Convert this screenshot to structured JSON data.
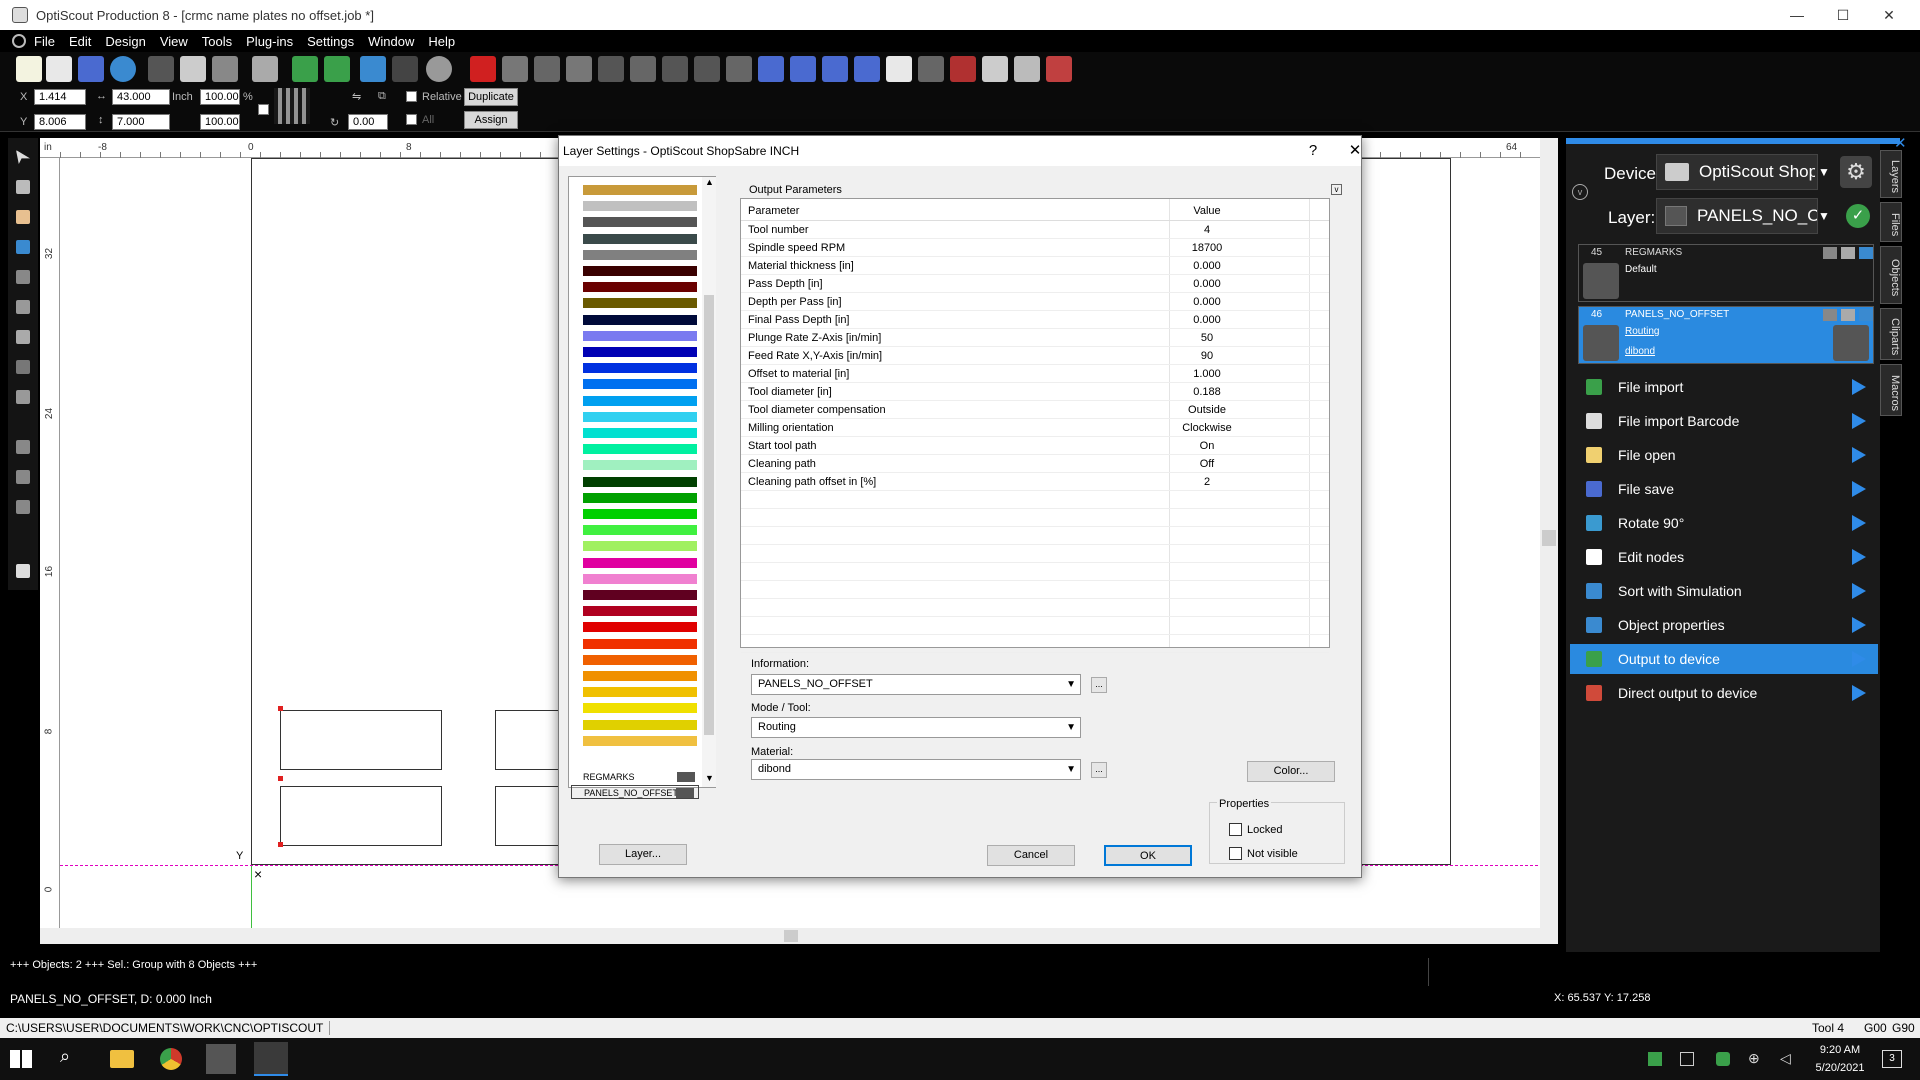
{
  "window": {
    "title": "OptiScout Production 8 - [crmc name plates no offset.job *]",
    "controls": [
      "—",
      "☐",
      "✕"
    ]
  },
  "menu": [
    "File",
    "Edit",
    "Design",
    "View",
    "Tools",
    "Plug-ins",
    "Settings",
    "Window",
    "Help"
  ],
  "propbar": {
    "x_label": "X",
    "x_value": "1.414",
    "y_label": "Y",
    "y_value": "8.006",
    "width_value": "43.000",
    "height_value": "7.000",
    "unit": "Inch",
    "scale_w": "100.00",
    "scale_h": "100.00",
    "percent": "%",
    "rotation": "0.00",
    "relative_label": "Relative",
    "all_label": "All",
    "duplicate_label": "Duplicate",
    "assign_label": "Assign"
  },
  "ruler": {
    "unit_label": "in",
    "x_ticks": [
      "-8",
      "0",
      "8",
      "64"
    ],
    "y_ticks": [
      "32",
      "24",
      "16",
      "8",
      "0"
    ]
  },
  "dialog": {
    "title": "Layer Settings - OptiScout ShopSabre INCH",
    "help": "?",
    "close": "✕",
    "group_label": "Output Parameters",
    "col_param": "Parameter",
    "col_value": "Value",
    "params": [
      {
        "name": "Tool number",
        "value": "4"
      },
      {
        "name": "Spindle speed RPM",
        "value": "18700"
      },
      {
        "name": "Material thickness [in]",
        "value": "0.000"
      },
      {
        "name": "Pass Depth [in]",
        "value": "0.000"
      },
      {
        "name": "Depth per Pass [in]",
        "value": "0.000"
      },
      {
        "name": "Final Pass Depth [in]",
        "value": "0.000"
      },
      {
        "name": "Plunge Rate Z-Axis [in/min]",
        "value": "50"
      },
      {
        "name": "Feed Rate X,Y-Axis [in/min]",
        "value": "90"
      },
      {
        "name": "Offset to material [in]",
        "value": "1.000"
      },
      {
        "name": "Tool diameter [in]",
        "value": "0.188"
      },
      {
        "name": "Tool diameter compensation",
        "value": "Outside"
      },
      {
        "name": "Milling orientation",
        "value": "Clockwise"
      },
      {
        "name": "Start tool path",
        "value": "On"
      },
      {
        "name": "Cleaning path",
        "value": "Off"
      },
      {
        "name": "Cleaning path offset in [%]",
        "value": "2"
      }
    ],
    "information_label": "Information:",
    "information_value": "PANELS_NO_OFFSET",
    "mode_label": "Mode / Tool:",
    "mode_value": "Routing",
    "material_label": "Material:",
    "material_value": "dibond",
    "color_button": "Color...",
    "properties_label": "Properties",
    "locked_label": "Locked",
    "not_visible_label": "Not visible",
    "layer_button": "Layer...",
    "cancel_button": "Cancel",
    "ok_button": "OK",
    "ellipsis": "...",
    "swatch_layers": [
      "REGMARKS",
      "PANELS_NO_OFFSET"
    ],
    "swatch_colors": [
      "#c89a3a",
      "#c0c0c0",
      "#555555",
      "#3a4a4a",
      "#808080",
      "#3a0000",
      "#6a0000",
      "#6a5a00",
      "#000a3a",
      "#7a7af0",
      "#0000b4",
      "#0030e0",
      "#0070f0",
      "#00a0f0",
      "#30d0f0",
      "#00e0d0",
      "#00f0a0",
      "#a0f0c0",
      "#004000",
      "#00a000",
      "#00d000",
      "#40f040",
      "#a0f060",
      "#e000a0",
      "#f080d0",
      "#600020",
      "#b00020",
      "#e00000",
      "#f03000",
      "#f06000",
      "#f09000",
      "#f0c000",
      "#f0e000",
      "#e0d000",
      "#f0c040"
    ]
  },
  "right_panel": {
    "device_label": "Device:",
    "device_value": "OptiScout Shop!",
    "layer_label": "Layer:",
    "layer_value": "PANELS_NO_OFF",
    "layers": [
      {
        "num": "45",
        "name": "REGMARKS",
        "line1": "Default",
        "line2": ""
      },
      {
        "num": "46",
        "name": "PANELS_NO_OFFSET",
        "line1": "Routing",
        "line2": "dibond"
      }
    ],
    "macros": [
      {
        "label": "File import",
        "icon_color": "#3aa04a"
      },
      {
        "label": "File import Barcode",
        "icon_color": "#dddddd"
      },
      {
        "label": "File open",
        "icon_color": "#f0d070"
      },
      {
        "label": "File save",
        "icon_color": "#4a6ad0"
      },
      {
        "label": "Rotate 90°",
        "icon_color": "#3a9ad0"
      },
      {
        "label": "Edit nodes",
        "icon_color": "#ffffff"
      },
      {
        "label": "Sort with Simulation",
        "icon_color": "#3a8ad0"
      },
      {
        "label": "Object properties",
        "icon_color": "#3a8ad0"
      },
      {
        "label": "Output to device",
        "icon_color": "#3aa04a"
      },
      {
        "label": "Direct output to device",
        "icon_color": "#d04a3a"
      }
    ],
    "selected_macro_index": 8,
    "side_tabs": [
      "Layers",
      "Files",
      "Objects",
      "Cliparts",
      "Macros"
    ]
  },
  "status": {
    "objects_line": "+++ Objects: 2 +++ Sel.: Group with 8 Objects  +++",
    "layer_line": "PANELS_NO_OFFSET, D: 0.000 Inch",
    "coords": "X: 65.537 Y: 17.258",
    "path": "C:\\USERS\\USER\\DOCUMENTS\\WORK\\CNC\\OPTISCOUT",
    "tool": "Tool 4",
    "g00": "G00",
    "g90": "G90"
  },
  "taskbar": {
    "time": "9:20 AM",
    "date": "5/20/2021",
    "notif_count": "3"
  },
  "colors": {
    "accent": "#2f8be8",
    "selected_layer": "#2a8ae0",
    "canvas": "#ffffff",
    "dark_bg": "#000000"
  }
}
